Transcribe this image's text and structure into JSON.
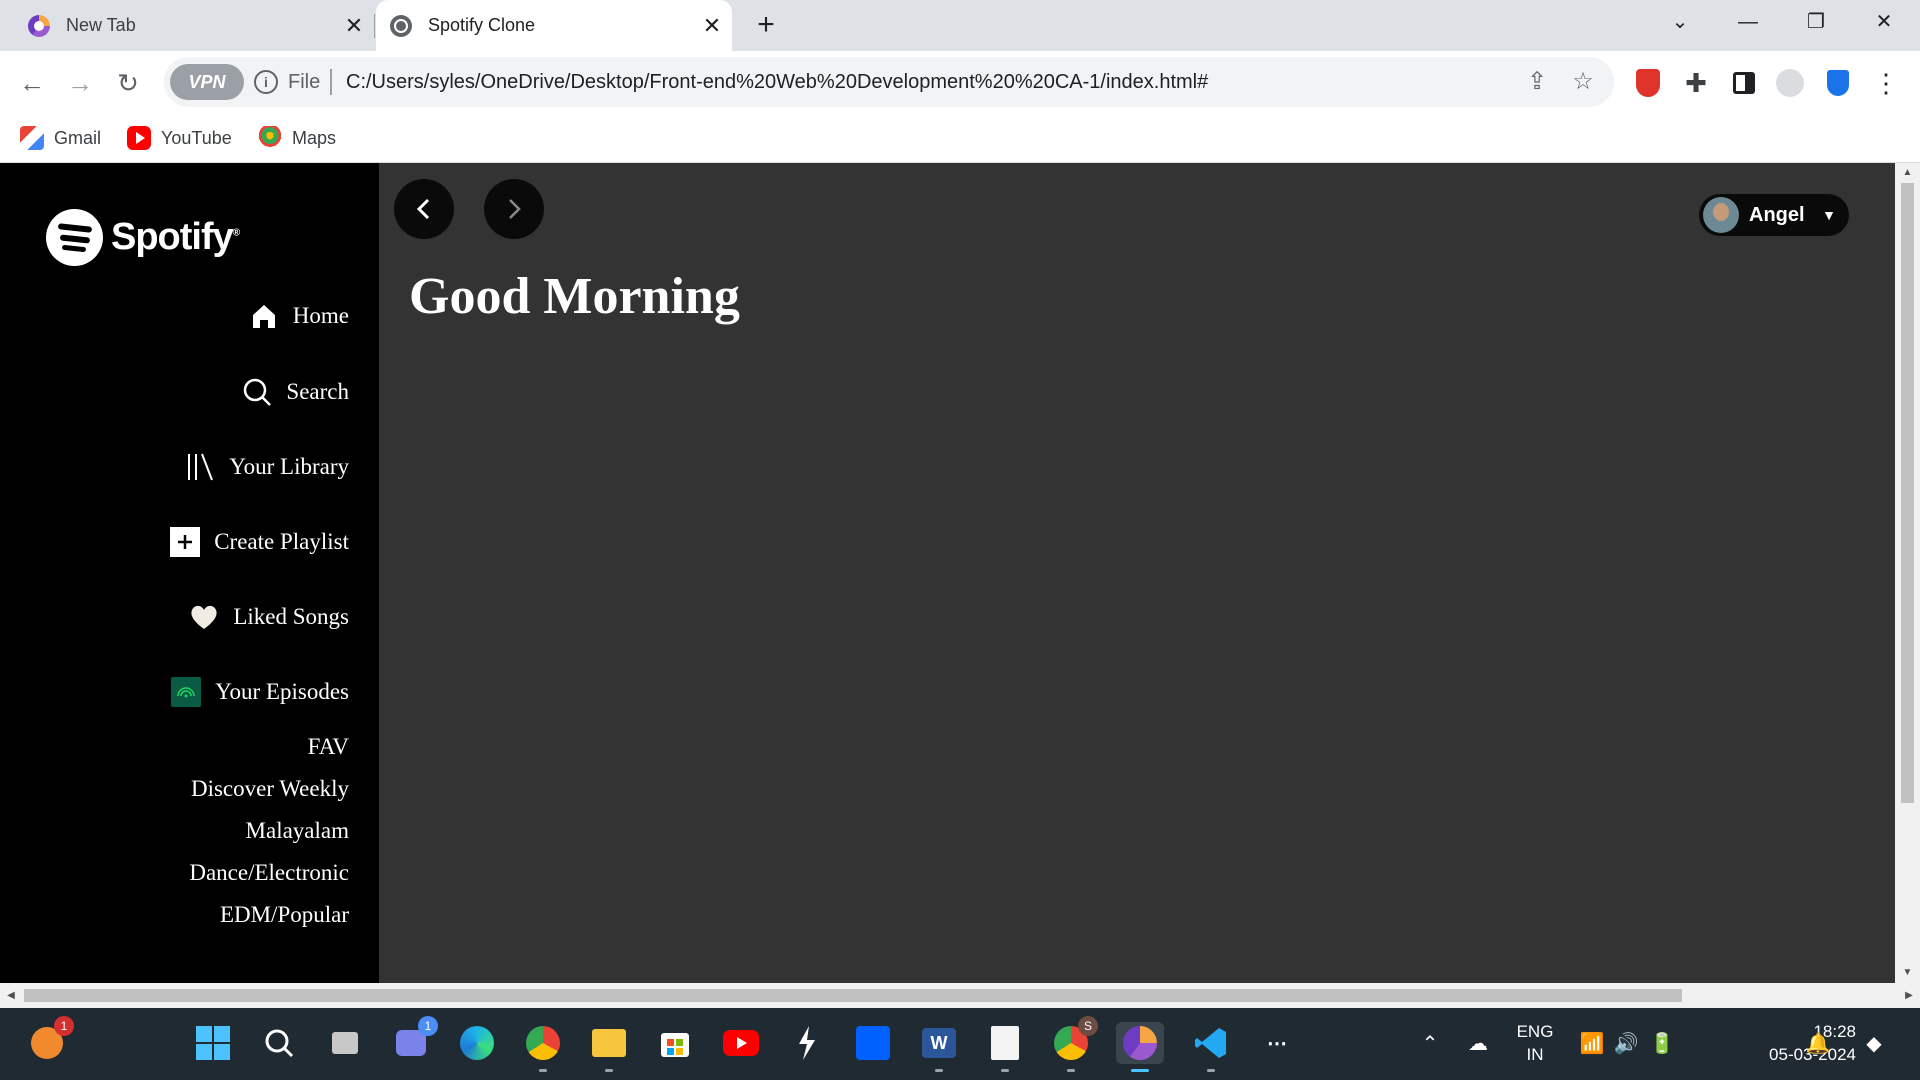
{
  "browser": {
    "tabs": [
      {
        "title": "New Tab",
        "active": false
      },
      {
        "title": "Spotify Clone",
        "active": true
      }
    ],
    "address": {
      "vpn_label": "VPN",
      "scheme_label": "File",
      "url": "C:/Users/syles/OneDrive/Desktop/Front-end%20Web%20Development%20%20CA-1/index.html#"
    },
    "bookmarks": [
      {
        "label": "Gmail",
        "icon": "gmail-icon"
      },
      {
        "label": "YouTube",
        "icon": "youtube-icon"
      },
      {
        "label": "Maps",
        "icon": "maps-icon"
      }
    ]
  },
  "page": {
    "logo_text": "Spotify",
    "logo_reg": "®",
    "nav": [
      {
        "label": "Home",
        "icon": "home-icon"
      },
      {
        "label": "Search",
        "icon": "search-icon"
      },
      {
        "label": "Your Library",
        "icon": "library-icon"
      },
      {
        "label": "Create Playlist",
        "icon": "plus-icon"
      },
      {
        "label": "Liked Songs",
        "icon": "heart-icon"
      },
      {
        "label": "Your Episodes",
        "icon": "episodes-icon"
      }
    ],
    "playlists": [
      "FAV",
      "Discover Weekly",
      "Malayalam",
      "Dance/Electronic",
      "EDM/Popular"
    ],
    "greeting": "Good Morning",
    "user": {
      "name": "Angel"
    }
  },
  "taskbar": {
    "notification_badge": "1",
    "teams_badge": "1",
    "chrome_badge": "S",
    "language": [
      "ENG",
      "IN"
    ],
    "time": "18:28",
    "date": "05-03-2024"
  },
  "colors": {
    "sidebar_bg": "#000000",
    "main_bg": "#333333",
    "episodes_accent": "#0b5a45"
  }
}
